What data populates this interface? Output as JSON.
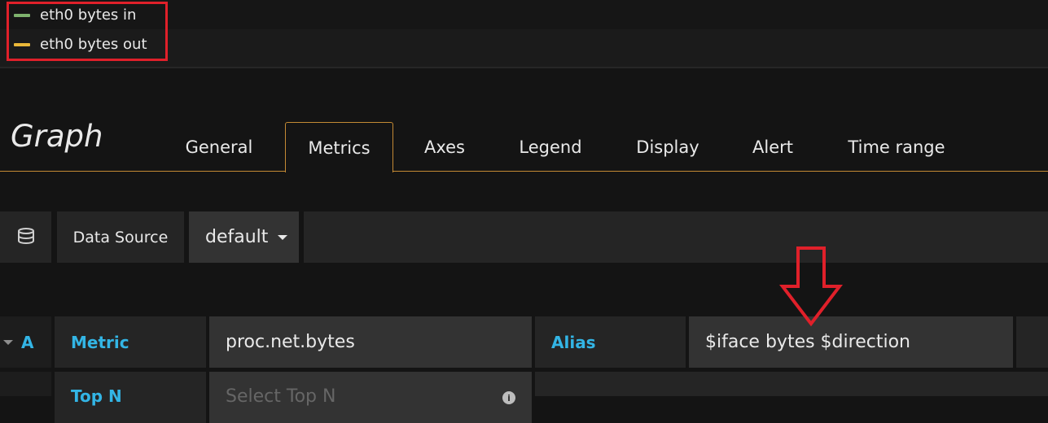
{
  "legend": {
    "items": [
      {
        "label": "eth0 bytes in",
        "color": "#7eb26d"
      },
      {
        "label": "eth0 bytes out",
        "color": "#eab839"
      }
    ]
  },
  "editor": {
    "title": "Graph",
    "tabs": [
      "General",
      "Metrics",
      "Axes",
      "Legend",
      "Display",
      "Alert",
      "Time range"
    ],
    "active_tab": "Metrics"
  },
  "datasource": {
    "icon": "database-icon",
    "label": "Data Source",
    "value": "default"
  },
  "query": {
    "letter": "A",
    "metric_label": "Metric",
    "metric_value": "proc.net.bytes",
    "alias_label": "Alias",
    "alias_value": "$iface bytes $direction",
    "topn_label": "Top N",
    "topn_placeholder": "Select Top N"
  },
  "colors": {
    "accent_orange": "#c48a34",
    "label_blue": "#33b5e5",
    "annotation_red": "#e0202a"
  }
}
